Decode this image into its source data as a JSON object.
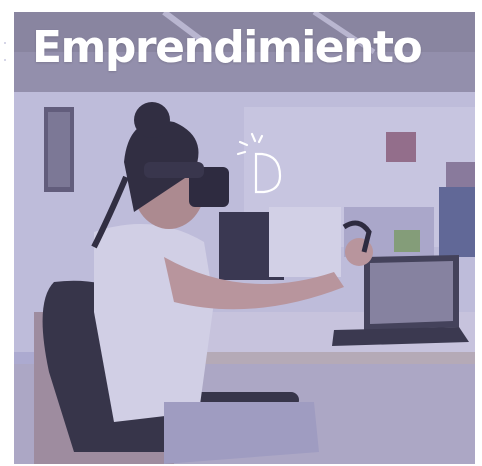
{
  "image": {
    "title": "Emprendimiento",
    "logo_icon": "idea-d-icon",
    "colors": {
      "overlay": "#7670b9",
      "title": "#ffffff"
    }
  }
}
